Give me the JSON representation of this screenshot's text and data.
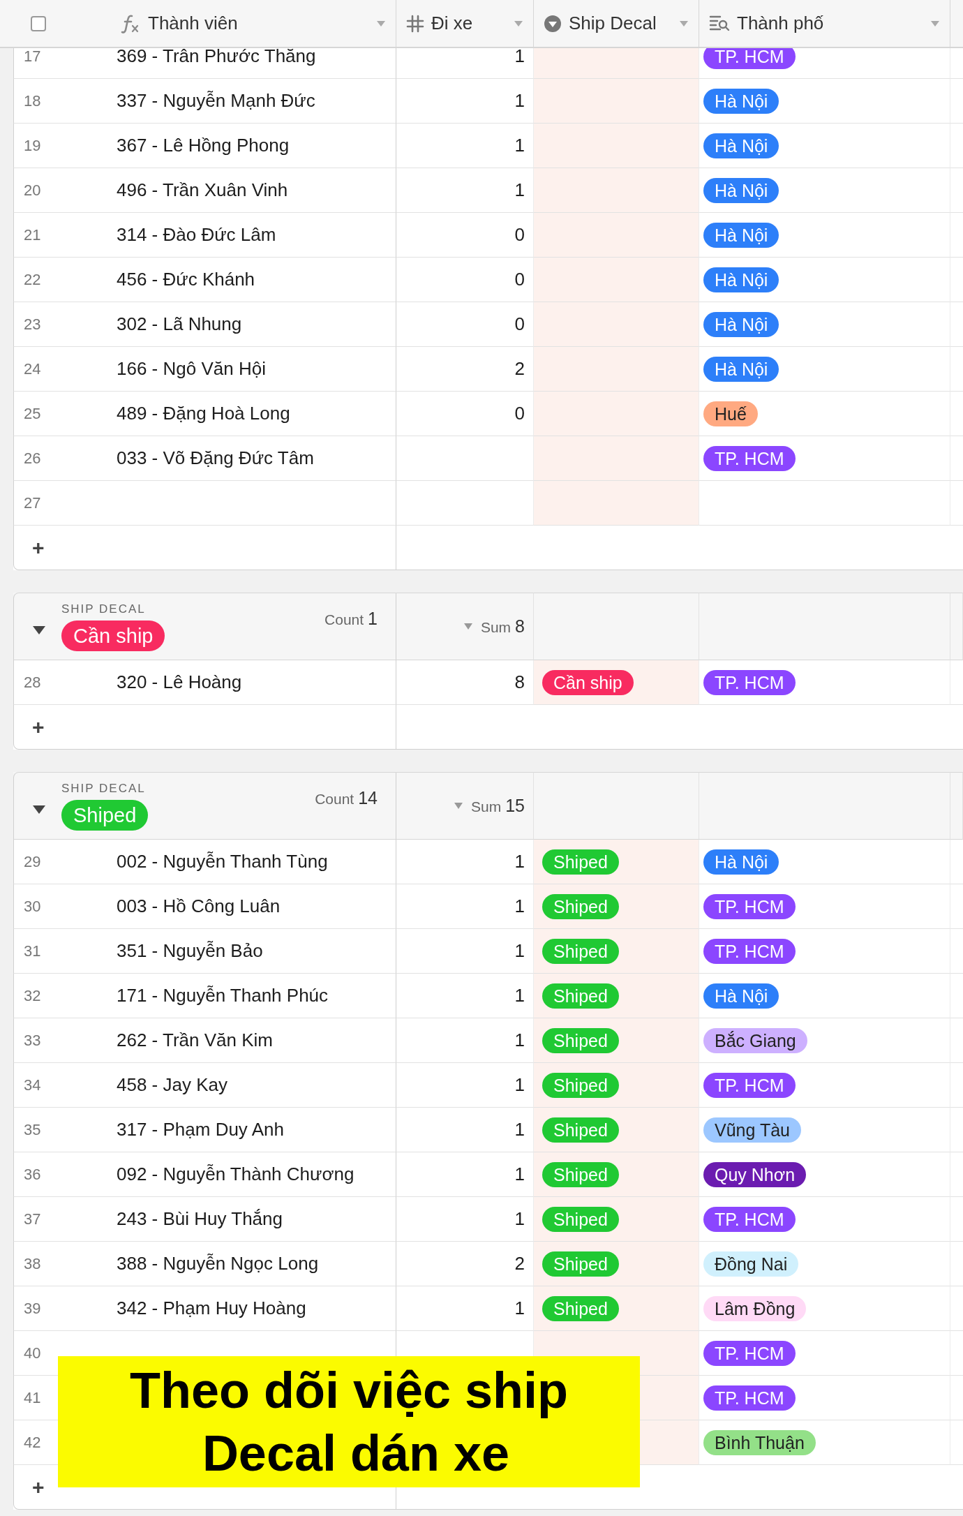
{
  "header": {
    "checked": false,
    "columns": [
      {
        "label": "Thành viên",
        "kind": "formula"
      },
      {
        "label": "Đi xe",
        "kind": "number"
      },
      {
        "label": "Ship Decal",
        "kind": "select"
      },
      {
        "label": "Thành phố",
        "kind": "lookup"
      }
    ]
  },
  "groups": [
    {
      "add": "+",
      "rows": [
        {
          "num": "17",
          "name": "369 - Trân Phước Thăng",
          "trips": "1",
          "city": {
            "label": "TP. HCM",
            "color": "#8b46ff"
          }
        },
        {
          "num": "18",
          "name": "337 - Nguyễn Mạnh Đức",
          "trips": "1",
          "city": {
            "label": "Hà Nội",
            "color": "#2d7ff9"
          }
        },
        {
          "num": "19",
          "name": "367 - Lê Hồng Phong",
          "trips": "1",
          "city": {
            "label": "Hà Nội",
            "color": "#2d7ff9"
          }
        },
        {
          "num": "20",
          "name": "496 - Trần Xuân Vinh",
          "trips": "1",
          "city": {
            "label": "Hà Nội",
            "color": "#2d7ff9"
          }
        },
        {
          "num": "21",
          "name": "314 - Đào Đức Lâm",
          "trips": "0",
          "city": {
            "label": "Hà Nội",
            "color": "#2d7ff9"
          }
        },
        {
          "num": "22",
          "name": "456 - Đức Khánh",
          "trips": "0",
          "city": {
            "label": "Hà Nội",
            "color": "#2d7ff9"
          }
        },
        {
          "num": "23",
          "name": "302 - Lã Nhung",
          "trips": "0",
          "city": {
            "label": "Hà Nội",
            "color": "#2d7ff9"
          }
        },
        {
          "num": "24",
          "name": "166 - Ngô Văn Hội",
          "trips": "2",
          "city": {
            "label": "Hà Nội",
            "color": "#2d7ff9"
          }
        },
        {
          "num": "25",
          "name": "489 - Đặng Hoà Long",
          "trips": "0",
          "city": {
            "label": "Huế",
            "color": "#ffa981"
          }
        },
        {
          "num": "26",
          "name": "033 - Võ Đặng Đức Tâm",
          "city": {
            "label": "TP. HCM",
            "color": "#8b46ff"
          }
        },
        {
          "num": "27"
        }
      ]
    },
    {
      "field": "SHIP DECAL",
      "expanded": true,
      "value": {
        "label": "Cần ship",
        "color": "#f82b60"
      },
      "count_label": "Count",
      "count": "1",
      "sum_label": "Sum",
      "sum": "8",
      "add": "+",
      "rows": [
        {
          "num": "28",
          "name": "320 - Lê Hoàng",
          "trips": "8",
          "ship": {
            "label": "Cần ship",
            "color": "#f82b60"
          },
          "city": {
            "label": "TP. HCM",
            "color": "#8b46ff"
          }
        }
      ]
    },
    {
      "field": "SHIP DECAL",
      "expanded": true,
      "value": {
        "label": "Shiped",
        "color": "#20c933"
      },
      "count_label": "Count",
      "count": "14",
      "sum_label": "Sum",
      "sum": "15",
      "add": "+",
      "rows": [
        {
          "num": "29",
          "name": "002 - Nguyễn Thanh Tùng",
          "trips": "1",
          "ship": {
            "label": "Shiped",
            "color": "#20c933"
          },
          "city": {
            "label": "Hà Nội",
            "color": "#2d7ff9"
          }
        },
        {
          "num": "30",
          "name": "003 - Hồ Công Luân",
          "trips": "1",
          "ship": {
            "label": "Shiped",
            "color": "#20c933"
          },
          "city": {
            "label": "TP. HCM",
            "color": "#8b46ff"
          }
        },
        {
          "num": "31",
          "name": "351 - Nguyễn Bảo",
          "trips": "1",
          "ship": {
            "label": "Shiped",
            "color": "#20c933"
          },
          "city": {
            "label": "TP. HCM",
            "color": "#8b46ff"
          }
        },
        {
          "num": "32",
          "name": "171 - Nguyễn Thanh Phúc",
          "trips": "1",
          "ship": {
            "label": "Shiped",
            "color": "#20c933"
          },
          "city": {
            "label": "Hà Nội",
            "color": "#2d7ff9"
          }
        },
        {
          "num": "33",
          "name": "262 - Trần Văn Kim",
          "trips": "1",
          "ship": {
            "label": "Shiped",
            "color": "#20c933"
          },
          "city": {
            "label": "Bắc Giang",
            "color": "#cdb0ff"
          }
        },
        {
          "num": "34",
          "name": "458 - Jay Kay",
          "trips": "1",
          "ship": {
            "label": "Shiped",
            "color": "#20c933"
          },
          "city": {
            "label": "TP. HCM",
            "color": "#8b46ff"
          }
        },
        {
          "num": "35",
          "name": "317 - Phạm Duy Anh",
          "trips": "1",
          "ship": {
            "label": "Shiped",
            "color": "#20c933"
          },
          "city": {
            "label": "Vũng Tàu",
            "color": "#9cc7ff"
          }
        },
        {
          "num": "36",
          "name": "092 - Nguyễn Thành Chương",
          "trips": "1",
          "ship": {
            "label": "Shiped",
            "color": "#20c933"
          },
          "city": {
            "label": "Quy Nhơn",
            "color": "#6b1cb0"
          }
        },
        {
          "num": "37",
          "name": "243 - Bùi Huy Thắng",
          "trips": "1",
          "ship": {
            "label": "Shiped",
            "color": "#20c933"
          },
          "city": {
            "label": "TP. HCM",
            "color": "#8b46ff"
          }
        },
        {
          "num": "38",
          "name": "388 - Nguyễn Ngọc Long",
          "trips": "2",
          "ship": {
            "label": "Shiped",
            "color": "#20c933"
          },
          "city": {
            "label": "Đồng Nai",
            "color": "#d0f0fd"
          }
        },
        {
          "num": "39",
          "name": "342 - Phạm Huy Hoàng",
          "trips": "1",
          "ship": {
            "label": "Shiped",
            "color": "#20c933"
          },
          "city": {
            "label": "Lâm Đồng",
            "color": "#ffdaf6"
          }
        },
        {
          "num": "40",
          "city": {
            "label": "TP. HCM",
            "color": "#8b46ff"
          }
        },
        {
          "num": "41",
          "city": {
            "label": "TP. HCM",
            "color": "#8b46ff"
          }
        },
        {
          "num": "42",
          "city": {
            "label": "Bình Thuận",
            "color": "#93e088"
          }
        }
      ]
    }
  ],
  "overlay": {
    "lines": [
      "Theo dõi việc ship",
      "Decal dán xe"
    ]
  }
}
